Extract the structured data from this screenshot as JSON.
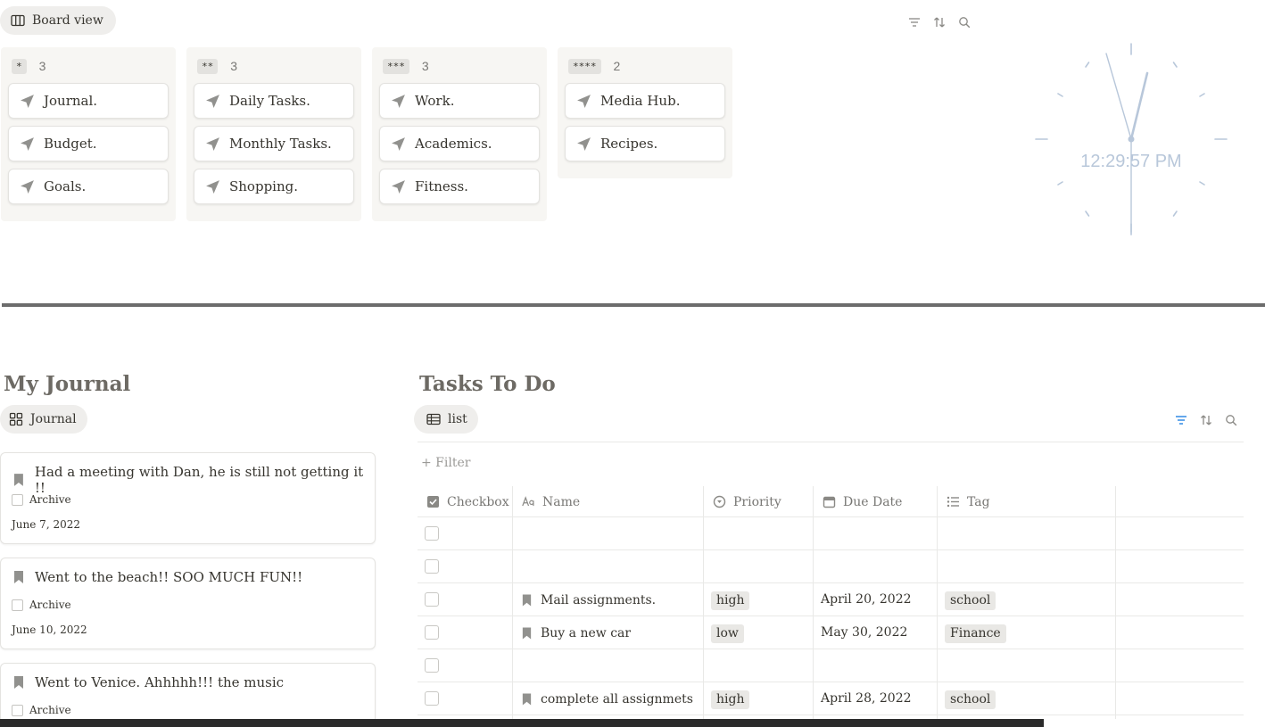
{
  "board": {
    "view_label": "Board view",
    "columns": [
      {
        "tag": "*",
        "count": "3",
        "cards": [
          "Journal.",
          "Budget.",
          "Goals."
        ]
      },
      {
        "tag": "**",
        "count": "3",
        "cards": [
          "Daily Tasks.",
          "Monthly Tasks.",
          "Shopping."
        ]
      },
      {
        "tag": "***",
        "count": "3",
        "cards": [
          "Work.",
          "Academics.",
          "Fitness."
        ]
      },
      {
        "tag": "****",
        "count": "2",
        "cards": [
          "Media Hub.",
          "Recipes."
        ]
      }
    ]
  },
  "clock": {
    "time": "12:29:57 PM",
    "color": "#b8c7da"
  },
  "journal": {
    "title": "My Journal",
    "view_label": "Journal",
    "entries": [
      {
        "title": "Had a meeting with Dan, he is still not getting it !!",
        "archive_label": "Archive",
        "date": "June 7, 2022"
      },
      {
        "title": "Went to the beach!! SOO MUCH FUN!!",
        "archive_label": "Archive",
        "date": "June 10, 2022"
      },
      {
        "title": "Went to Venice. Ahhhhh!!! the music",
        "archive_label": "Archive",
        "date": ""
      }
    ]
  },
  "tasks": {
    "title": "Tasks To Do",
    "view_label": "list",
    "filter_label": "+ Filter",
    "columns": [
      "Checkbox",
      "Name",
      "Priority",
      "Due Date",
      "Tag"
    ],
    "rows": [
      {
        "name": "",
        "priority": "",
        "due": "",
        "tag": ""
      },
      {
        "name": "",
        "priority": "",
        "due": "",
        "tag": ""
      },
      {
        "name": "Mail assignments.",
        "priority": "high",
        "due": "April 20, 2022",
        "tag": "school"
      },
      {
        "name": "Buy a new car",
        "priority": "low",
        "due": "May 30, 2022",
        "tag": "Finance"
      },
      {
        "name": "",
        "priority": "",
        "due": "",
        "tag": ""
      },
      {
        "name": "complete all assignmets",
        "priority": "high",
        "due": "April 28, 2022",
        "tag": "school"
      }
    ]
  },
  "icons": {
    "board_view": "columns-icon",
    "card": "arrow-pointer-icon",
    "journal_view": "gallery-icon",
    "list_view": "table-icon",
    "entry": "bookmark-icon",
    "filter": "filter-icon",
    "sort": "sort-icon",
    "search": "search-icon"
  },
  "colors": {
    "accent_filter": "#2383e2"
  }
}
